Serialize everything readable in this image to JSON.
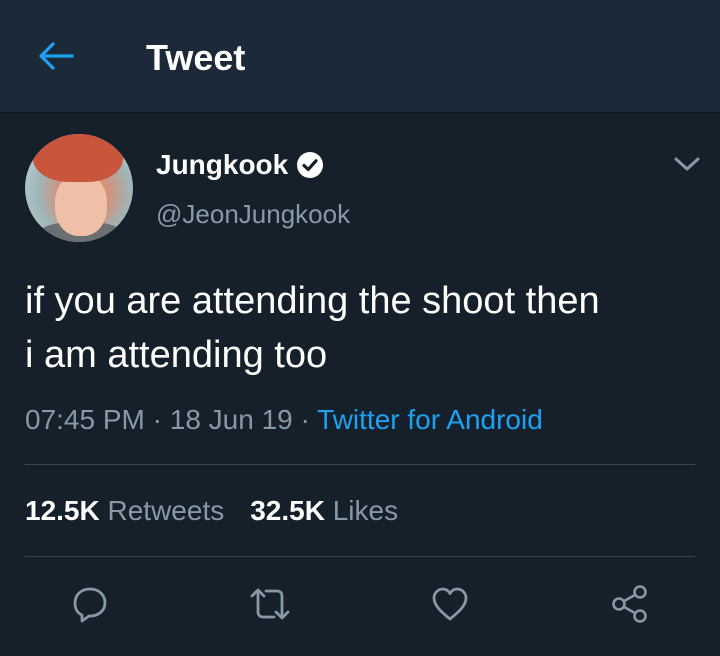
{
  "header": {
    "title": "Tweet"
  },
  "author": {
    "name": "Jungkook",
    "handle": "@JeonJungkook",
    "verified": true
  },
  "tweet": {
    "line1": "if you are attending the shoot then",
    "line2": "i am attending too"
  },
  "meta": {
    "time": "07:45 PM",
    "date": "18 Jun 19",
    "source": "Twitter for Android",
    "sep": " · "
  },
  "stats": {
    "retweets_count": "12.5K",
    "retweets_label": "Retweets",
    "likes_count": "32.5K",
    "likes_label": "Likes"
  },
  "icons": {
    "back": "arrow-left-icon",
    "verified": "verified-badge-icon",
    "caret": "chevron-down-icon",
    "reply": "reply-icon",
    "retweet": "retweet-icon",
    "like": "heart-icon",
    "share": "share-icon"
  },
  "colors": {
    "background": "#15202b",
    "header": "#1c2938",
    "accent": "#1da1f2",
    "secondary_text": "#8899a6",
    "divider": "#38444d"
  }
}
